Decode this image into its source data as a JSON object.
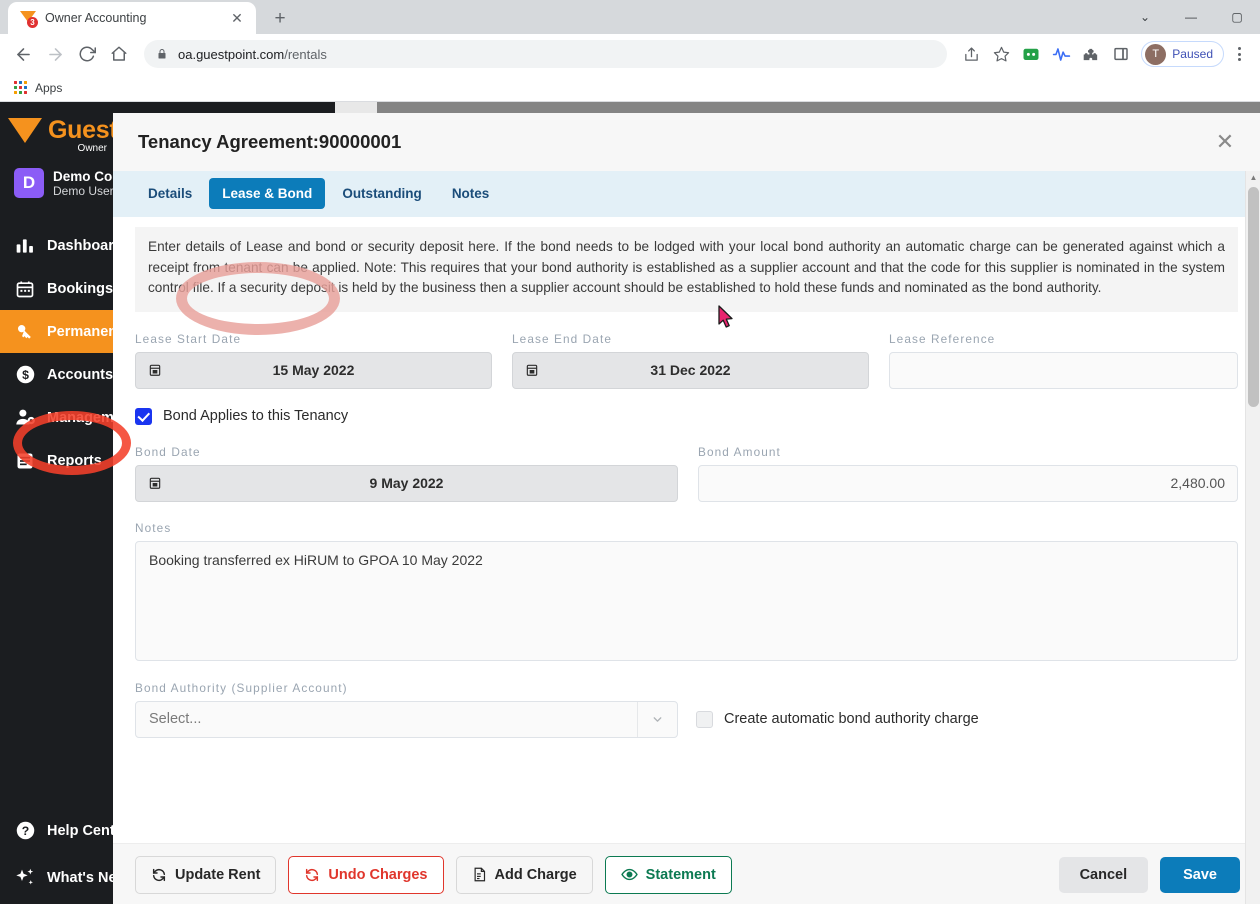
{
  "browser": {
    "tab": {
      "title": "Owner Accounting",
      "badge": "3",
      "close_label": "✕"
    },
    "newtab_label": "+",
    "window": {
      "minimize": "—",
      "maximize": "▢",
      "close": "✕",
      "collapse": "⌄"
    },
    "nav": {
      "back": "←",
      "forward": "→",
      "reload": "⟳",
      "home": "⌂"
    },
    "omnibox": {
      "url_domain": "oa.guestpoint.com",
      "url_path": "/rentals",
      "lock_icon": "lock-icon"
    },
    "toolbar_icons": [
      "share-icon",
      "bookmark-star-icon",
      "extension-green-icon",
      "extension-waveform-icon",
      "extensions-puzzle-icon",
      "side-panel-icon"
    ],
    "profile": {
      "initial": "T",
      "status": "Paused"
    },
    "bookmarks": {
      "apps_label": "Apps"
    }
  },
  "sidebar": {
    "brand": {
      "name": "Guest",
      "subtitle": "Owner"
    },
    "user": {
      "initial": "D",
      "name": "Demo Co",
      "role": "Demo User"
    },
    "items": [
      {
        "label": "Dashboard",
        "icon": "bar-chart-icon",
        "active": false
      },
      {
        "label": "Bookings",
        "icon": "calendar-icon",
        "active": false
      },
      {
        "label": "Permanent",
        "icon": "key-icon",
        "active": true
      },
      {
        "label": "Accounts",
        "icon": "dollar-circle-icon",
        "active": false
      },
      {
        "label": "Management",
        "icon": "user-gear-icon",
        "active": false
      },
      {
        "label": "Reports",
        "icon": "document-list-icon",
        "active": false
      }
    ],
    "bottom_items": [
      {
        "label": "Help Center",
        "icon": "question-circle-icon"
      },
      {
        "label": "What's New",
        "icon": "sparkle-icon"
      }
    ]
  },
  "modal": {
    "title": "Tenancy Agreement:90000001",
    "close_label": "✕",
    "tabs": [
      {
        "label": "Details",
        "active": false
      },
      {
        "label": "Lease & Bond",
        "active": true
      },
      {
        "label": "Outstanding",
        "active": false
      },
      {
        "label": "Notes",
        "active": false
      }
    ],
    "description": "Enter details of Lease and bond or security deposit here. If the bond needs to be lodged with your local bond authority an automatic charge can be generated against which a receipt from tenant can be applied. Note: This requires that your bond authority is established as a supplier account and that the code for this supplier is nominated in the system control file. If a security deposit is held by the business then a supplier account should be established to hold these funds and nominated as the bond authority.",
    "fields": {
      "lease_start_date": {
        "label": "Lease Start Date",
        "value": "15 May 2022"
      },
      "lease_end_date": {
        "label": "Lease End Date",
        "value": "31 Dec 2022"
      },
      "lease_reference": {
        "label": "Lease Reference",
        "value": "",
        "placeholder": ""
      },
      "bond_applies": {
        "label": "Bond Applies to this Tenancy",
        "checked": true
      },
      "bond_date": {
        "label": "Bond Date",
        "value": "9 May 2022"
      },
      "bond_amount": {
        "label": "Bond Amount",
        "value": "2,480.00"
      },
      "notes": {
        "label": "Notes",
        "value": "Booking transferred ex HiRUM to GPOA 10 May 2022"
      },
      "bond_authority": {
        "label": "Bond Authority (Supplier Account)",
        "value": "Select...",
        "caret": "⌄"
      },
      "auto_charge": {
        "label": "Create automatic bond authority charge",
        "checked": false
      }
    },
    "footer": {
      "update_rent": {
        "label": "Update Rent",
        "icon": "refresh-icon"
      },
      "undo_charges": {
        "label": "Undo Charges",
        "icon": "refresh-icon"
      },
      "add_charge": {
        "label": "Add Charge",
        "icon": "invoice-icon"
      },
      "statement": {
        "label": "Statement",
        "icon": "eye-icon"
      },
      "cancel": {
        "label": "Cancel"
      },
      "save": {
        "label": "Save"
      }
    }
  },
  "colors": {
    "brand_orange": "#f5921e",
    "sidebar_bg": "#1b1d20",
    "accent_blue": "#0c7cba",
    "tabbar_bg": "#e3f0f7",
    "danger_red": "#e0362c",
    "success_green": "#0c7a52",
    "annotation_red": "#f4402a",
    "annotation_pink": "#e8a09a",
    "checkbox_blue": "#1a35f0"
  }
}
